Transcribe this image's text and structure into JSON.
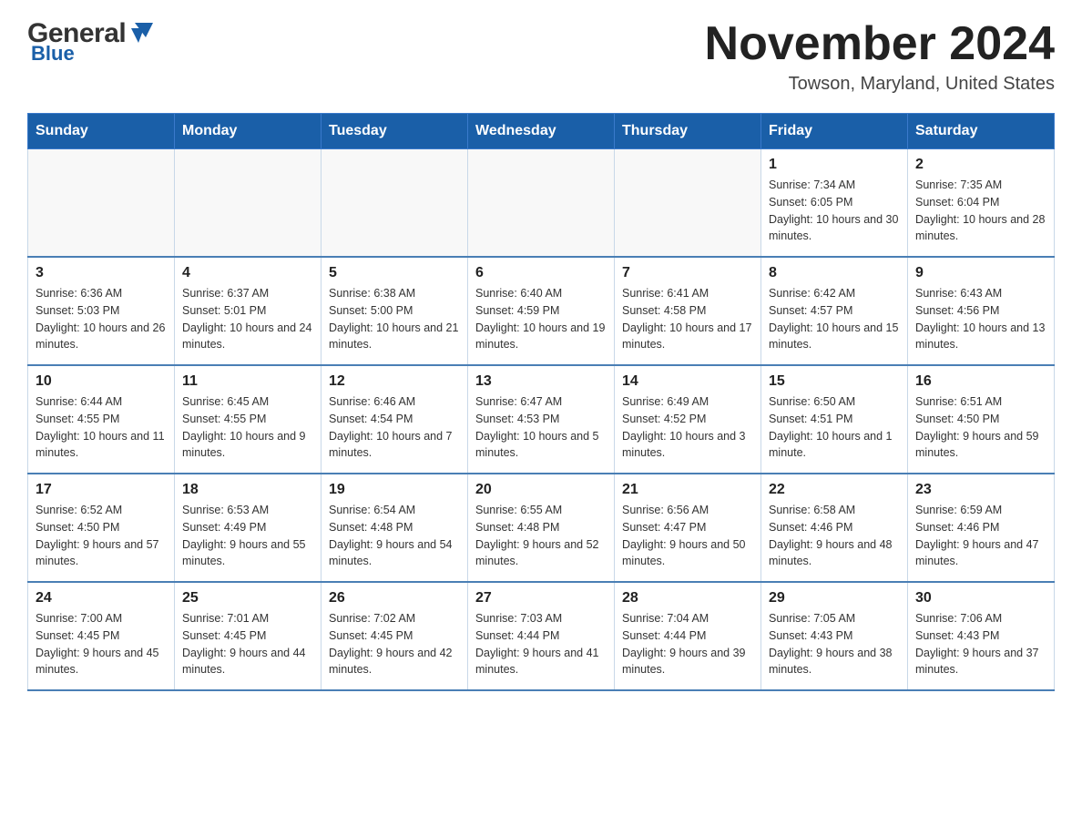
{
  "logo": {
    "general": "General",
    "blue": "Blue"
  },
  "title": {
    "month": "November 2024",
    "location": "Towson, Maryland, United States"
  },
  "weekdays": [
    "Sunday",
    "Monday",
    "Tuesday",
    "Wednesday",
    "Thursday",
    "Friday",
    "Saturday"
  ],
  "weeks": [
    [
      {
        "day": "",
        "info": ""
      },
      {
        "day": "",
        "info": ""
      },
      {
        "day": "",
        "info": ""
      },
      {
        "day": "",
        "info": ""
      },
      {
        "day": "",
        "info": ""
      },
      {
        "day": "1",
        "info": "Sunrise: 7:34 AM\nSunset: 6:05 PM\nDaylight: 10 hours and 30 minutes."
      },
      {
        "day": "2",
        "info": "Sunrise: 7:35 AM\nSunset: 6:04 PM\nDaylight: 10 hours and 28 minutes."
      }
    ],
    [
      {
        "day": "3",
        "info": "Sunrise: 6:36 AM\nSunset: 5:03 PM\nDaylight: 10 hours and 26 minutes."
      },
      {
        "day": "4",
        "info": "Sunrise: 6:37 AM\nSunset: 5:01 PM\nDaylight: 10 hours and 24 minutes."
      },
      {
        "day": "5",
        "info": "Sunrise: 6:38 AM\nSunset: 5:00 PM\nDaylight: 10 hours and 21 minutes."
      },
      {
        "day": "6",
        "info": "Sunrise: 6:40 AM\nSunset: 4:59 PM\nDaylight: 10 hours and 19 minutes."
      },
      {
        "day": "7",
        "info": "Sunrise: 6:41 AM\nSunset: 4:58 PM\nDaylight: 10 hours and 17 minutes."
      },
      {
        "day": "8",
        "info": "Sunrise: 6:42 AM\nSunset: 4:57 PM\nDaylight: 10 hours and 15 minutes."
      },
      {
        "day": "9",
        "info": "Sunrise: 6:43 AM\nSunset: 4:56 PM\nDaylight: 10 hours and 13 minutes."
      }
    ],
    [
      {
        "day": "10",
        "info": "Sunrise: 6:44 AM\nSunset: 4:55 PM\nDaylight: 10 hours and 11 minutes."
      },
      {
        "day": "11",
        "info": "Sunrise: 6:45 AM\nSunset: 4:55 PM\nDaylight: 10 hours and 9 minutes."
      },
      {
        "day": "12",
        "info": "Sunrise: 6:46 AM\nSunset: 4:54 PM\nDaylight: 10 hours and 7 minutes."
      },
      {
        "day": "13",
        "info": "Sunrise: 6:47 AM\nSunset: 4:53 PM\nDaylight: 10 hours and 5 minutes."
      },
      {
        "day": "14",
        "info": "Sunrise: 6:49 AM\nSunset: 4:52 PM\nDaylight: 10 hours and 3 minutes."
      },
      {
        "day": "15",
        "info": "Sunrise: 6:50 AM\nSunset: 4:51 PM\nDaylight: 10 hours and 1 minute."
      },
      {
        "day": "16",
        "info": "Sunrise: 6:51 AM\nSunset: 4:50 PM\nDaylight: 9 hours and 59 minutes."
      }
    ],
    [
      {
        "day": "17",
        "info": "Sunrise: 6:52 AM\nSunset: 4:50 PM\nDaylight: 9 hours and 57 minutes."
      },
      {
        "day": "18",
        "info": "Sunrise: 6:53 AM\nSunset: 4:49 PM\nDaylight: 9 hours and 55 minutes."
      },
      {
        "day": "19",
        "info": "Sunrise: 6:54 AM\nSunset: 4:48 PM\nDaylight: 9 hours and 54 minutes."
      },
      {
        "day": "20",
        "info": "Sunrise: 6:55 AM\nSunset: 4:48 PM\nDaylight: 9 hours and 52 minutes."
      },
      {
        "day": "21",
        "info": "Sunrise: 6:56 AM\nSunset: 4:47 PM\nDaylight: 9 hours and 50 minutes."
      },
      {
        "day": "22",
        "info": "Sunrise: 6:58 AM\nSunset: 4:46 PM\nDaylight: 9 hours and 48 minutes."
      },
      {
        "day": "23",
        "info": "Sunrise: 6:59 AM\nSunset: 4:46 PM\nDaylight: 9 hours and 47 minutes."
      }
    ],
    [
      {
        "day": "24",
        "info": "Sunrise: 7:00 AM\nSunset: 4:45 PM\nDaylight: 9 hours and 45 minutes."
      },
      {
        "day": "25",
        "info": "Sunrise: 7:01 AM\nSunset: 4:45 PM\nDaylight: 9 hours and 44 minutes."
      },
      {
        "day": "26",
        "info": "Sunrise: 7:02 AM\nSunset: 4:45 PM\nDaylight: 9 hours and 42 minutes."
      },
      {
        "day": "27",
        "info": "Sunrise: 7:03 AM\nSunset: 4:44 PM\nDaylight: 9 hours and 41 minutes."
      },
      {
        "day": "28",
        "info": "Sunrise: 7:04 AM\nSunset: 4:44 PM\nDaylight: 9 hours and 39 minutes."
      },
      {
        "day": "29",
        "info": "Sunrise: 7:05 AM\nSunset: 4:43 PM\nDaylight: 9 hours and 38 minutes."
      },
      {
        "day": "30",
        "info": "Sunrise: 7:06 AM\nSunset: 4:43 PM\nDaylight: 9 hours and 37 minutes."
      }
    ]
  ],
  "colors": {
    "header_bg": "#1a5fa8",
    "header_text": "#ffffff",
    "border": "#4a7fb5",
    "empty_bg": "#f8f8f8"
  }
}
